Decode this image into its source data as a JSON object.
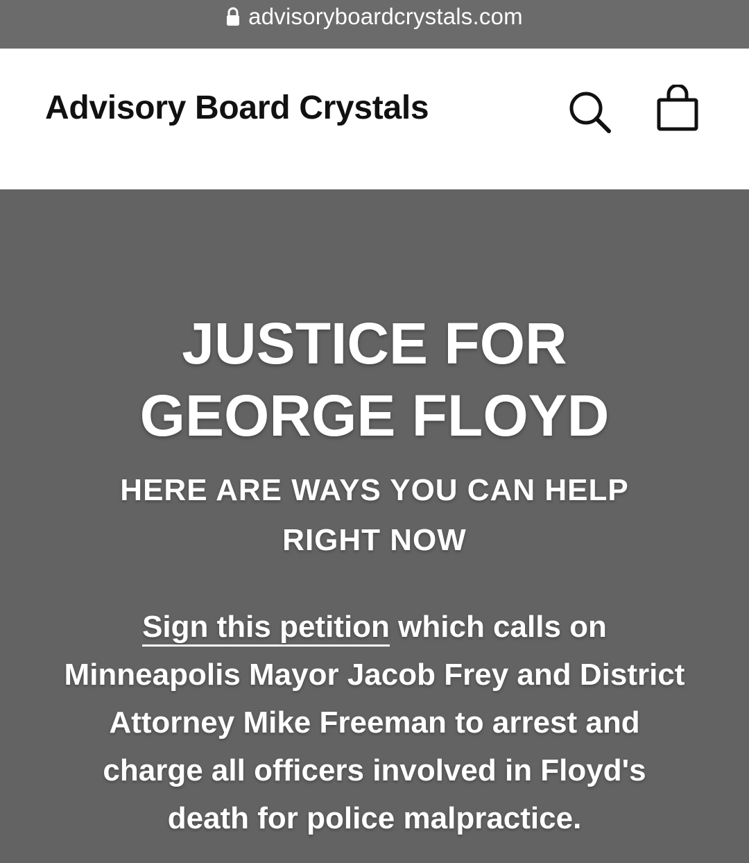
{
  "browser": {
    "url": "advisoryboardcrystals.com",
    "lock_icon": "lock-icon"
  },
  "header": {
    "site_title": "Advisory Board Crystals",
    "search_icon": "search-icon",
    "cart_icon": "shopping-bag-icon"
  },
  "hero": {
    "title_line1": "JUSTICE FOR",
    "title_line2": "GEORGE FLOYD",
    "subtitle_line1": "HERE ARE WAYS YOU CAN HELP",
    "subtitle_line2": "RIGHT NOW",
    "petition_link": "Sign this petition",
    "body_line1_rest": " which calls on",
    "body_line2": "Minneapolis Mayor Jacob Frey and District",
    "body_line3": "Attorney Mike Freeman to arrest and",
    "body_line4": "charge all officers involved in Floyd's",
    "body_line5": "death for police malpractice."
  },
  "colors": {
    "browser_bar": "#6b6b6b",
    "header_bg": "#ffffff",
    "hero_bg": "#646364",
    "text_light": "#ffffff",
    "text_dark": "#111111"
  }
}
